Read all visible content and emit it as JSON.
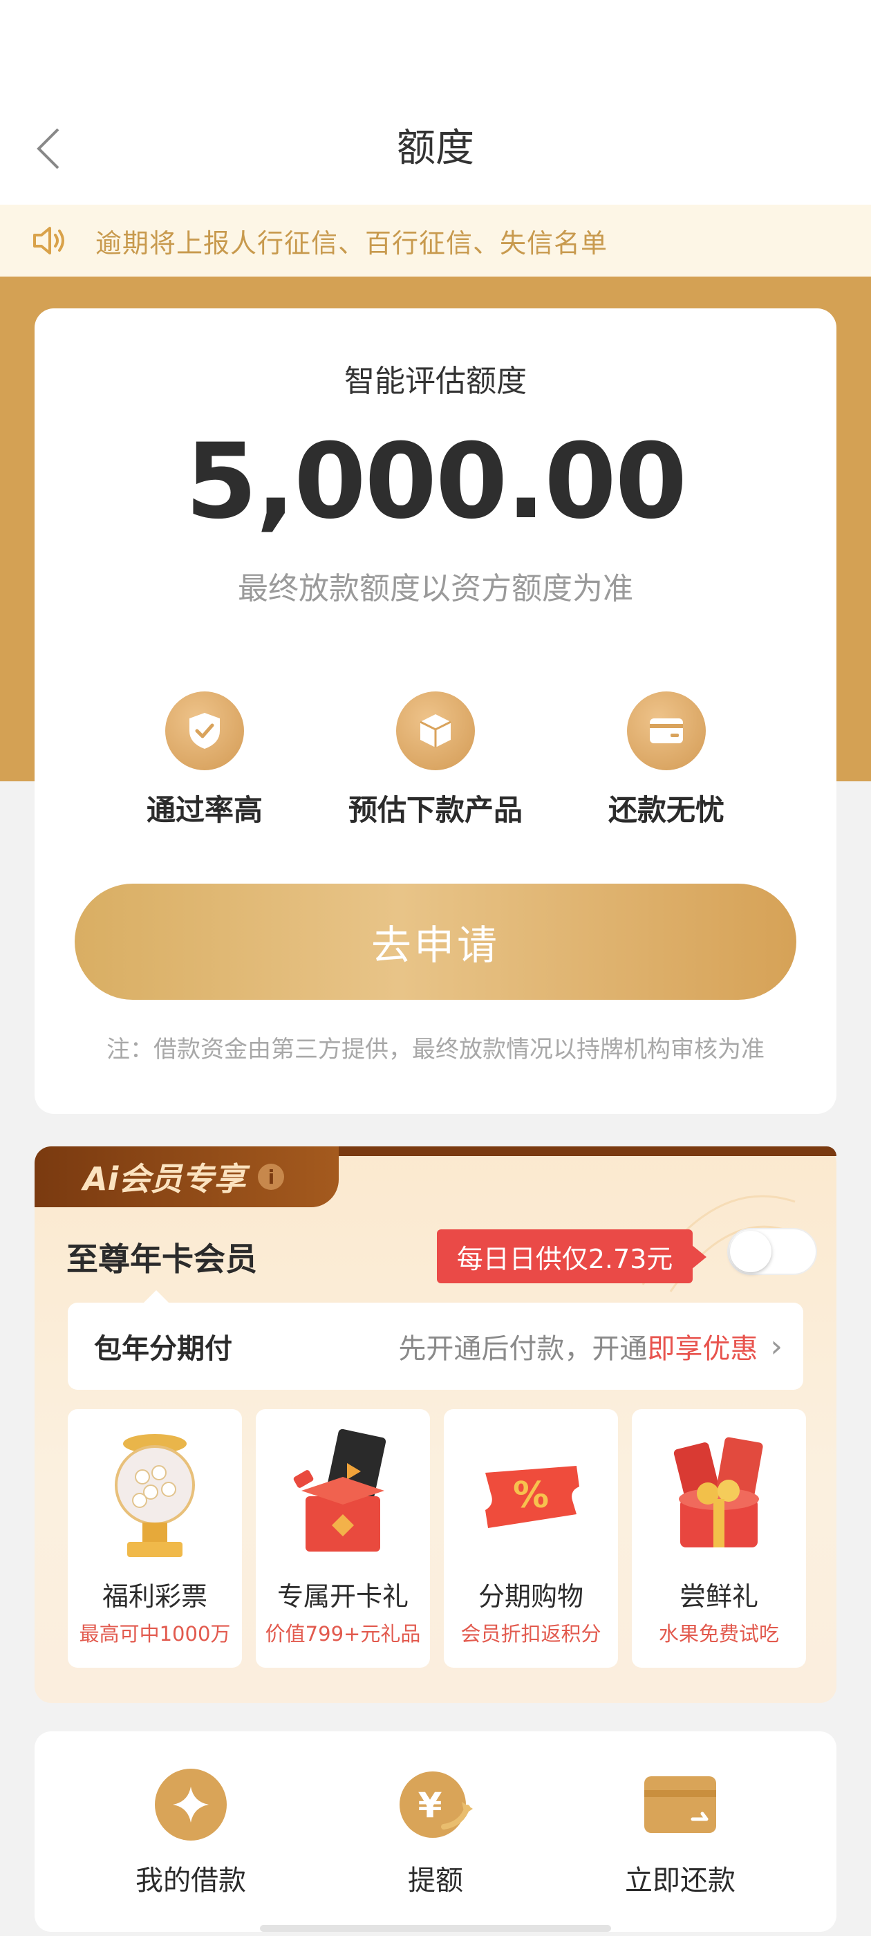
{
  "nav": {
    "title": "额度"
  },
  "notice": {
    "text": "逾期将上报人行征信、百行征信、失信名单"
  },
  "quota": {
    "label": "智能评估额度",
    "amount": "5,000.00",
    "note": "最终放款额度以资方额度为准"
  },
  "features": [
    {
      "label": "通过率高",
      "icon": "shield-check-icon"
    },
    {
      "label": "预估下款产品",
      "icon": "box-icon"
    },
    {
      "label": "还款无忧",
      "icon": "card-icon"
    }
  ],
  "apply": {
    "label": "去申请"
  },
  "disclaimer": "注：借款资金由第三方提供，最终放款情况以持牌机构审核为准",
  "member": {
    "tab_label": "Ai会员专享",
    "vip_title": "至尊年卡会员",
    "price_badge": "每日日供仅2.73元",
    "toggle_on": false,
    "installment_label": "包年分期付",
    "installment_desc": "先开通后付款，开通",
    "installment_highlight": "即享优惠",
    "perks": [
      {
        "title": "福利彩票",
        "subtitle": "最高可中1000万",
        "icon": "lottery-icon"
      },
      {
        "title": "专属开卡礼",
        "subtitle": "价值799+元礼品",
        "icon": "gift-box-icon"
      },
      {
        "title": "分期购物",
        "subtitle": "会员折扣返积分",
        "icon": "coupon-icon"
      },
      {
        "title": "尝鲜礼",
        "subtitle": "水果免费试吃",
        "icon": "red-envelope-icon"
      }
    ]
  },
  "bottom_nav": [
    {
      "label": "我的借款",
      "icon": "diamond-icon"
    },
    {
      "label": "提额",
      "icon": "yen-up-icon"
    },
    {
      "label": "立即还款",
      "icon": "repay-card-icon"
    }
  ],
  "colors": {
    "gold": "#d4a154",
    "accent_red": "#ea4a47",
    "notice_text": "#c89a4e"
  }
}
